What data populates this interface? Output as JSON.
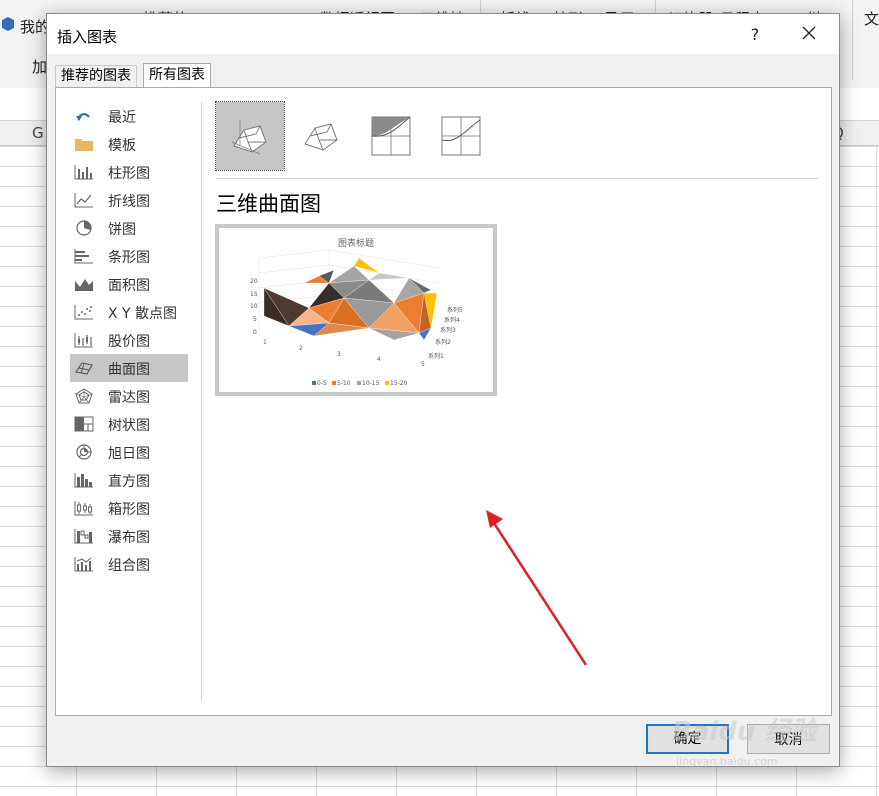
{
  "ribbon": {
    "my_label": "我的",
    "add_label": "加",
    "recommended_label": "推荐的",
    "pivot_label": "数据透视图",
    "three_d_label": "三维地",
    "line_label": "折线",
    "column_label": "柱形",
    "winloss_label": "盈亏",
    "slicer_label": "切片器",
    "timeline_label": "日程表",
    "link_label": "链",
    "text_label": "文"
  },
  "columns": {
    "g": "G",
    "q": "Q"
  },
  "dialog": {
    "title": "插入图表",
    "help_glyph": "?",
    "tabs": [
      {
        "label": "推荐的图表"
      },
      {
        "label": "所有图表"
      }
    ],
    "chart_types": [
      {
        "label": "最近",
        "icon": "recent-undo-icon"
      },
      {
        "label": "模板",
        "icon": "folder-icon"
      },
      {
        "label": "柱形图",
        "icon": "column-chart-icon"
      },
      {
        "label": "折线图",
        "icon": "line-chart-icon"
      },
      {
        "label": "饼图",
        "icon": "pie-chart-icon"
      },
      {
        "label": "条形图",
        "icon": "bar-chart-icon"
      },
      {
        "label": "面积图",
        "icon": "area-chart-icon"
      },
      {
        "label": "X Y 散点图",
        "icon": "scatter-chart-icon"
      },
      {
        "label": "股价图",
        "icon": "stock-chart-icon"
      },
      {
        "label": "曲面图",
        "icon": "surface-chart-icon"
      },
      {
        "label": "雷达图",
        "icon": "radar-chart-icon"
      },
      {
        "label": "树状图",
        "icon": "treemap-icon"
      },
      {
        "label": "旭日图",
        "icon": "sunburst-icon"
      },
      {
        "label": "直方图",
        "icon": "histogram-icon"
      },
      {
        "label": "箱形图",
        "icon": "box-whisker-icon"
      },
      {
        "label": "瀑布图",
        "icon": "waterfall-icon"
      },
      {
        "label": "组合图",
        "icon": "combo-chart-icon"
      }
    ],
    "selected_chart_type": "曲面图",
    "subtype_title": "三维曲面图",
    "ok_label": "确定",
    "cancel_label": "取消"
  },
  "preview": {
    "title": "图表标题",
    "y_ticks": [
      "20",
      "15",
      "10",
      "5",
      "0"
    ],
    "x_ticks": [
      "1",
      "2",
      "3",
      "4",
      "5"
    ],
    "series": [
      "系列5",
      "系列4",
      "系列3",
      "系列2",
      "系列1"
    ],
    "legend": [
      {
        "label": "0-5",
        "color": "#4472c4"
      },
      {
        "label": "5-10",
        "color": "#ed7d31"
      },
      {
        "label": "10-15",
        "color": "#a5a5a5"
      },
      {
        "label": "15-20",
        "color": "#ffc000"
      }
    ]
  },
  "watermark": {
    "name": "Baidu 经验",
    "url": "jingyan.baidu.com"
  },
  "colors": {
    "accent": "#1e74d0",
    "selection": "#c6c6c6",
    "arrow": "#e02020"
  }
}
